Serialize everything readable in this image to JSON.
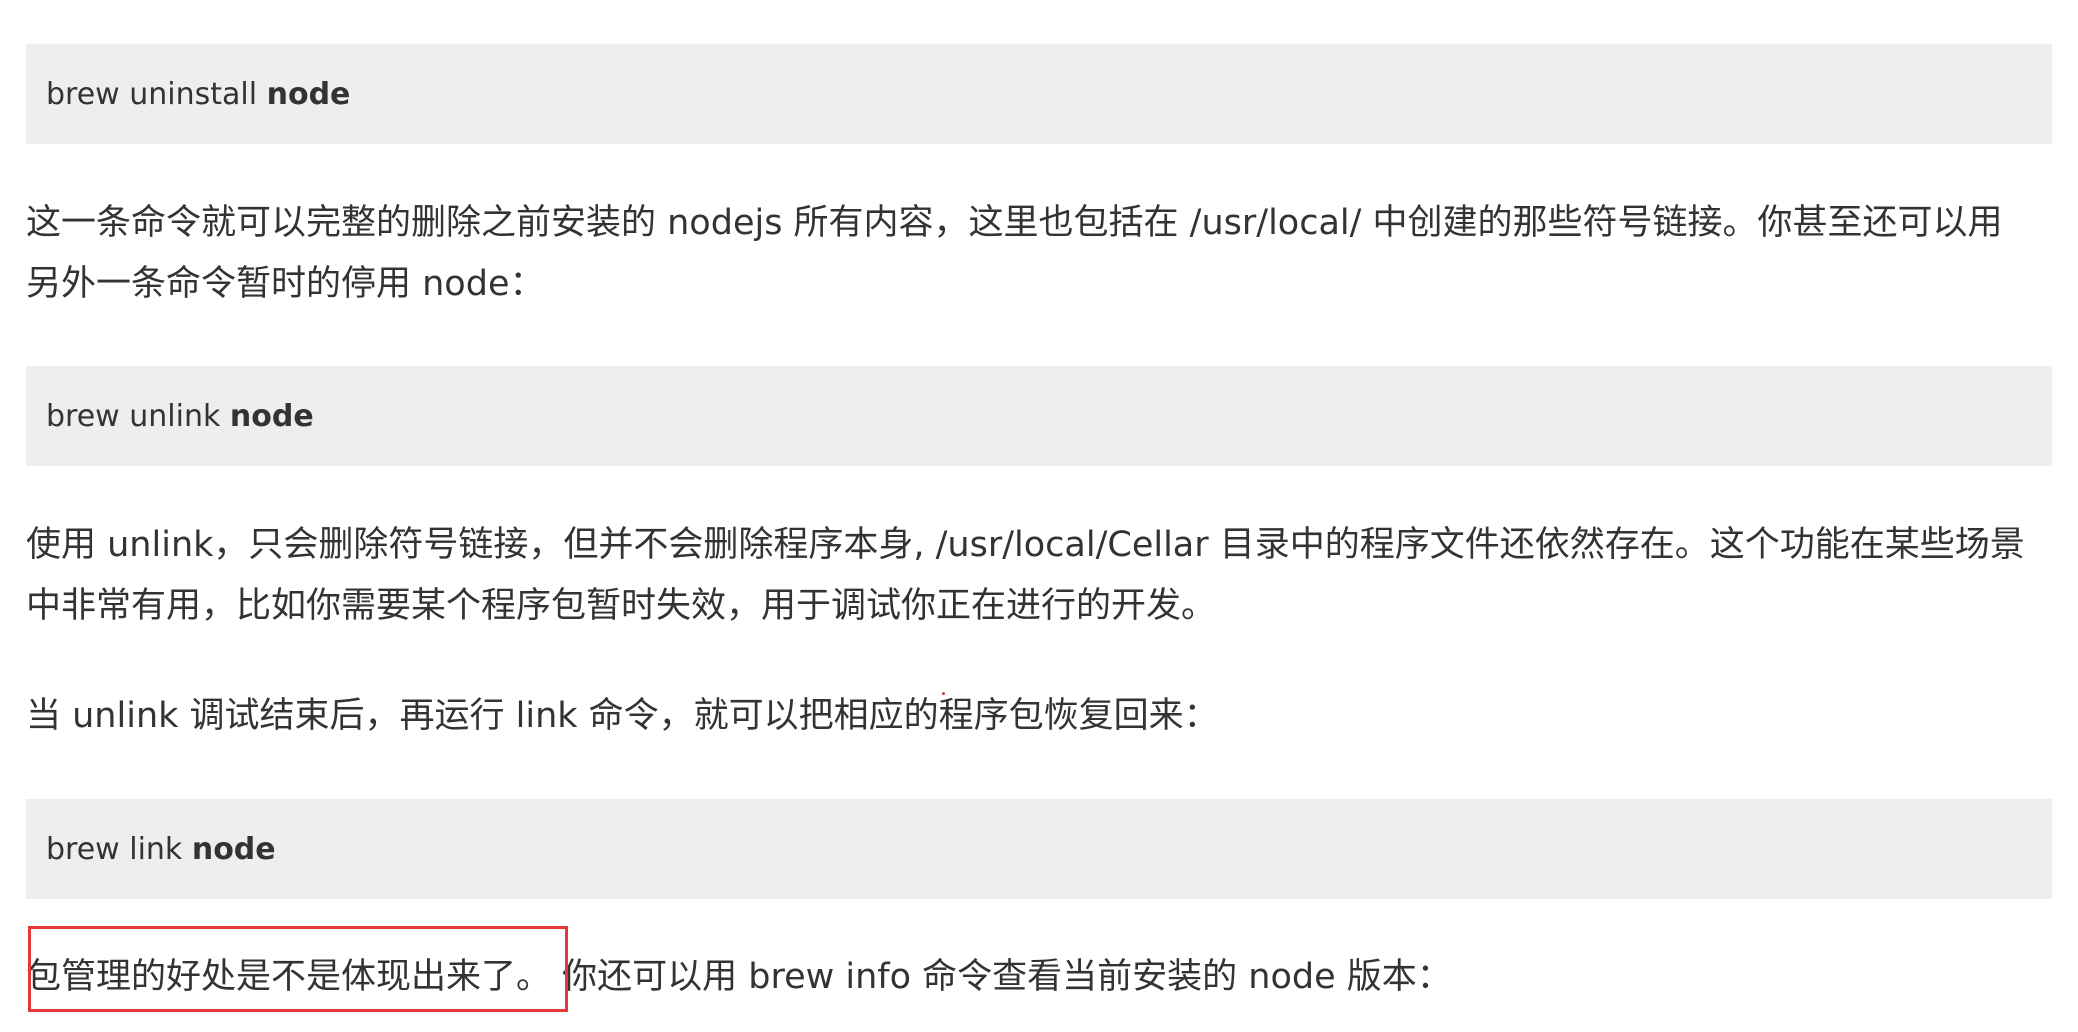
{
  "blocks": {
    "code1": {
      "prefix": "brew uninstall ",
      "bold": "node"
    },
    "para1": {
      "line1": "这一条命令就可以完整的删除之前安装的 nodejs 所有内容，这里也包括在 /usr/local/ 中创建的那些符号链接。你甚至还可以用",
      "line2": "另外一条命令暂时的停用 node："
    },
    "code2": {
      "prefix": "brew unlink ",
      "bold": "node"
    },
    "para2": {
      "line1": "使用 unlink，只会删除符号链接，但并不会删除程序本身, /usr/local/Cellar 目录中的程序文件还依然存在。这个功能在某些场景",
      "line2": "中非常有用，比如你需要某个程序包暂时失效，用于调试你正在进行的开发。"
    },
    "para3": {
      "line1": "当 unlink 调试结束后，再运行 link 命令，就可以把相应的程序包恢复回来："
    },
    "code3": {
      "prefix": "brew link ",
      "bold": "node"
    },
    "para4": {
      "highlighted": "包管理的好处是不是体现出来了。",
      "rest": " 你还可以用 brew info 命令查看当前安装的 node 版本："
    }
  },
  "colors": {
    "code_background": "#eeeeee",
    "text": "#333333",
    "highlight_border": "#e53935"
  }
}
